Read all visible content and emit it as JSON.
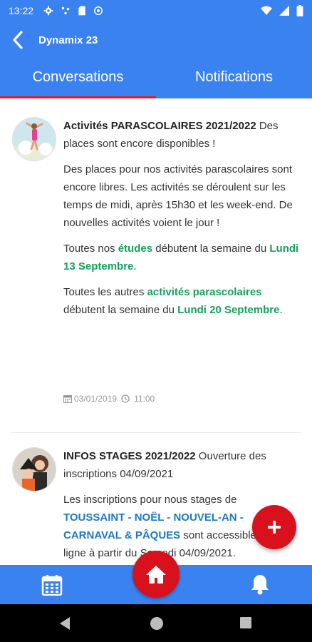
{
  "status": {
    "time": "13:22"
  },
  "header": {
    "title": "Dynamix 23"
  },
  "tabs": [
    {
      "label": "Conversations",
      "active": true
    },
    {
      "label": "Notifications",
      "active": false
    }
  ],
  "posts": [
    {
      "title": "Activités PARASCOLAIRES 2021/2022",
      "subtitle": " Des places sont encore disponibles !",
      "p1": "Des places pour nos activités parascolaires sont encore libres. Les activités se déroulent sur les temps de midi, après 15h30 et les week-end. De nouvelles activités voient le jour !",
      "p2a": "Toutes nos ",
      "p2b": "études",
      "p2c": " débutent la semaine du ",
      "p2d": "Lundi 13 Septembre",
      "p2e": ".",
      "p3a": "Toutes les autres ",
      "p3b": "activités parascolaires",
      "p3c": " débutent la semaine du ",
      "p3d": "Lundi 20 Septembre",
      "p3e": ".",
      "date": "03/01/2019",
      "time": "11:00"
    },
    {
      "title": "INFOS STAGES 2021/2022",
      "subtitle": " Ouverture des inscriptions 04/09/2021",
      "p1a": "Les inscriptions pour nous stages de ",
      "p1b": "TOUSSAINT - NOËL - NOUVEL-AN - CARNAVAL & PÂQUES",
      "p1c": " sont accessibles en ligne à partir du Samedi 04/09/2021."
    }
  ],
  "colors": {
    "primary": "#3b82f1",
    "accent": "#d8111c",
    "green": "#17a05d",
    "blue": "#1d78c1"
  },
  "icons": {
    "fab": "plus-icon",
    "home": "home-icon",
    "calendar": "calendar-icon",
    "notifications": "bell-icon"
  }
}
